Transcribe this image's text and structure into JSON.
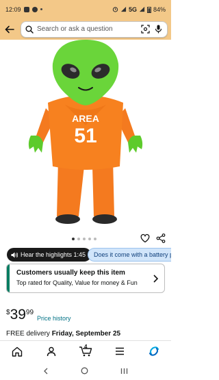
{
  "status_bar": {
    "time": "12:09",
    "network": "5G",
    "battery": "84%"
  },
  "search": {
    "placeholder": "Search or ask a question"
  },
  "product": {
    "image_alt": "Inflatable alien costume in orange AREA 51 jumpsuit",
    "jumpsuit_text_line1": "AREA",
    "jumpsuit_text_line2": "51",
    "image_count": 5,
    "active_image_index": 0
  },
  "highlights": {
    "audio_label": "Hear the highlights 1:45",
    "question_chip": "Does it come with a battery pa"
  },
  "keep_card": {
    "title": "Customers usually keep this item",
    "subtitle": "Top rated for Quality, Value for money & Fun"
  },
  "price": {
    "symbol": "$",
    "whole": "39",
    "fraction": "99",
    "history_link": "Price history"
  },
  "delivery": {
    "prefix": "FREE delivery ",
    "date": "Friday, September 25"
  },
  "bottom_nav": {
    "cart_count": "4"
  },
  "colors": {
    "header_bg": "#f3c888",
    "accent_link": "#007185",
    "keep_bar": "#067d62",
    "active_nav": "#00a8e1"
  }
}
